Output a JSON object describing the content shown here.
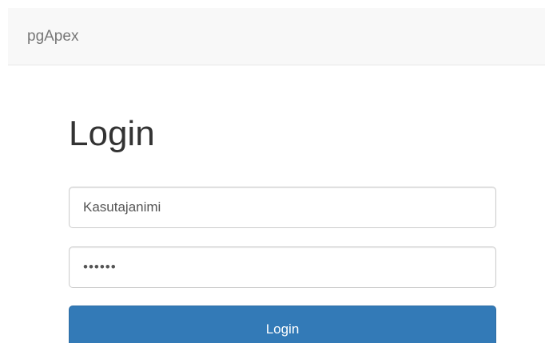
{
  "navbar": {
    "brand": "pgApex"
  },
  "login": {
    "title": "Login",
    "username_placeholder": "Kasutajanimi",
    "password_value": "••••••",
    "button_label": "Login"
  },
  "colors": {
    "navbar_background": "#f8f8f8",
    "brand_text": "#777777",
    "primary_button": "#337ab7",
    "input_border": "#cccccc"
  }
}
